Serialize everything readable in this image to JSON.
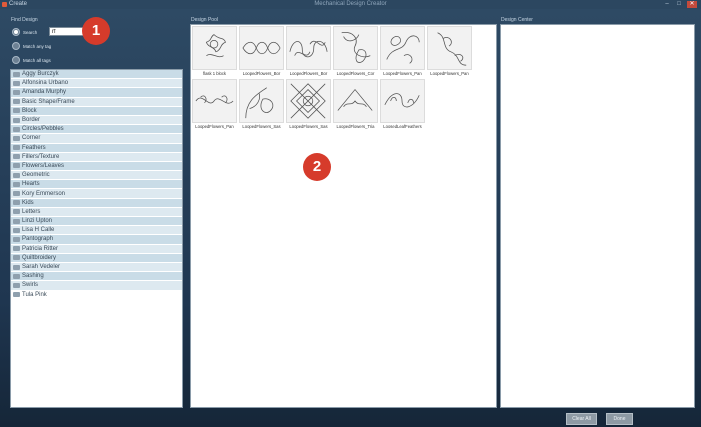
{
  "window": {
    "app_name": "Create",
    "title": "Mechanical Design Creator",
    "minimize_glyph": "–",
    "maximize_glyph": "□",
    "close_glyph": "✕"
  },
  "find_design": {
    "label": "Find Design",
    "search_label": "Search",
    "search_value": "rf",
    "match_any_label": "Match any tag",
    "match_all_label": "Match all tags"
  },
  "tags": [
    "Aggy Burczyk",
    "Alfonsina Urbano",
    "Amanda Murphy",
    "Basic Shape/Frame",
    "Block",
    "Border",
    "Circles/Pebbles",
    "Corner",
    "Feathers",
    "Fillers/Texture",
    "Flowers/Leaves",
    "Geometric",
    "Hearts",
    "Kory Emmerson",
    "Kids",
    "Letters",
    "Linzi Upton",
    "Lisa H Calle",
    "Pantograph",
    "Patricia Ritter",
    "Quiltbroidery",
    "Sarah Vedeler",
    "Sashing",
    "Swirls",
    "Tula Pink"
  ],
  "design_pool": {
    "label": "Design Pool",
    "designs": [
      "flask 1 block",
      "LoopedFlowers_Bor",
      "LoopedFlowers_Bor",
      "LoopedFlowers_Cor",
      "LoopedFlowers_Pan",
      "LoopedFlowers_Pan",
      "LoopedFlowers_Pan",
      "LoopedFlowers_Sas",
      "LoopedFlowers_Sas",
      "LoopedFlowers_Tria",
      "LoosedLeafFeathers"
    ]
  },
  "design_center": {
    "label": "Design Center"
  },
  "callouts": {
    "first": "1",
    "second": "2"
  },
  "buttons": {
    "clear_all": "Clear All",
    "done": "Done"
  },
  "colors": {
    "accent": "#d63b2b",
    "list_row": "#c9dce7",
    "workspace": "#2e4a64"
  }
}
